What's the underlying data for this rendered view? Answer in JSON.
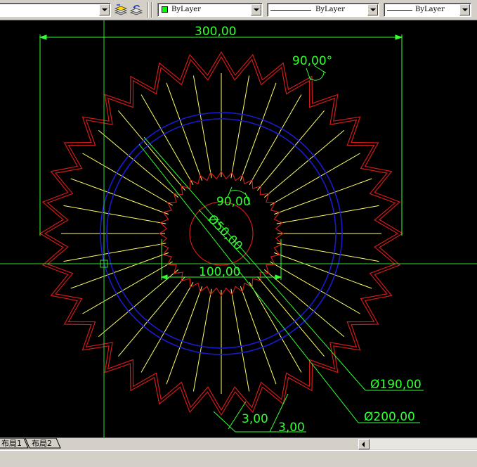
{
  "toolbar": {
    "layer_state_value": "",
    "color_combo": {
      "value": "ByLayer",
      "swatch_color": "#00ff00"
    },
    "linetype_combo": {
      "value": "ByLayer"
    },
    "lineweight_combo": {
      "value": "ByLayer"
    }
  },
  "drawing": {
    "colors": {
      "background": "#000000",
      "outer_gear": "#d01a1a",
      "spokes": "#ffff66",
      "circles": "#1a1ad0",
      "dimensions": "#33ff33",
      "crosshair": "#33dd33"
    },
    "dimensions": {
      "width_top": "300,00",
      "angle_top": "90,00°",
      "angle_inner": "90,00",
      "dia_inner": "Ø50,00",
      "width_inner": "100,00",
      "dia_190": "Ø190,00",
      "dia_200": "Ø200,00",
      "tooth_a": "3,00",
      "tooth_b": "3,00"
    }
  },
  "tabs": {
    "layout1": "布局1",
    "layout2": "布局2"
  }
}
